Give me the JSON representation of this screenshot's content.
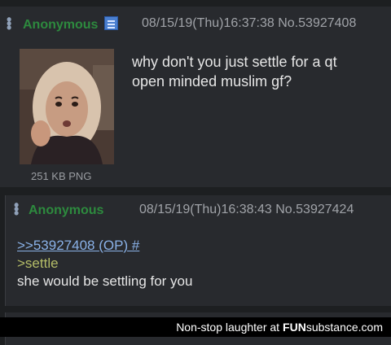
{
  "post1": {
    "name": "Anonymous",
    "datetime": "08/15/19(Thu)16:37:38",
    "number": "No.53927408",
    "file_info": "251 KB PNG",
    "comment_line1": "why don't you just settle for a qt",
    "comment_line2": "open minded muslim gf?",
    "flag_icon": "flag-icon"
  },
  "post2": {
    "name": "Anonymous",
    "datetime": "08/15/19(Thu)16:38:43",
    "number": "No.53927424",
    "quote_link": ">>53927408 (OP) #",
    "greentext": ">settle",
    "reply": "she would be settling for you"
  },
  "watermark": {
    "text": "Non-stop laughter at",
    "brand_fun": "FUN",
    "brand_substance": "substance.com"
  },
  "colors": {
    "background": "#1d1f21",
    "post_bg": "#282a2e",
    "name": "#2d8a3e",
    "quote_link": "#8ab2e8",
    "greentext": "#b5bd68"
  }
}
